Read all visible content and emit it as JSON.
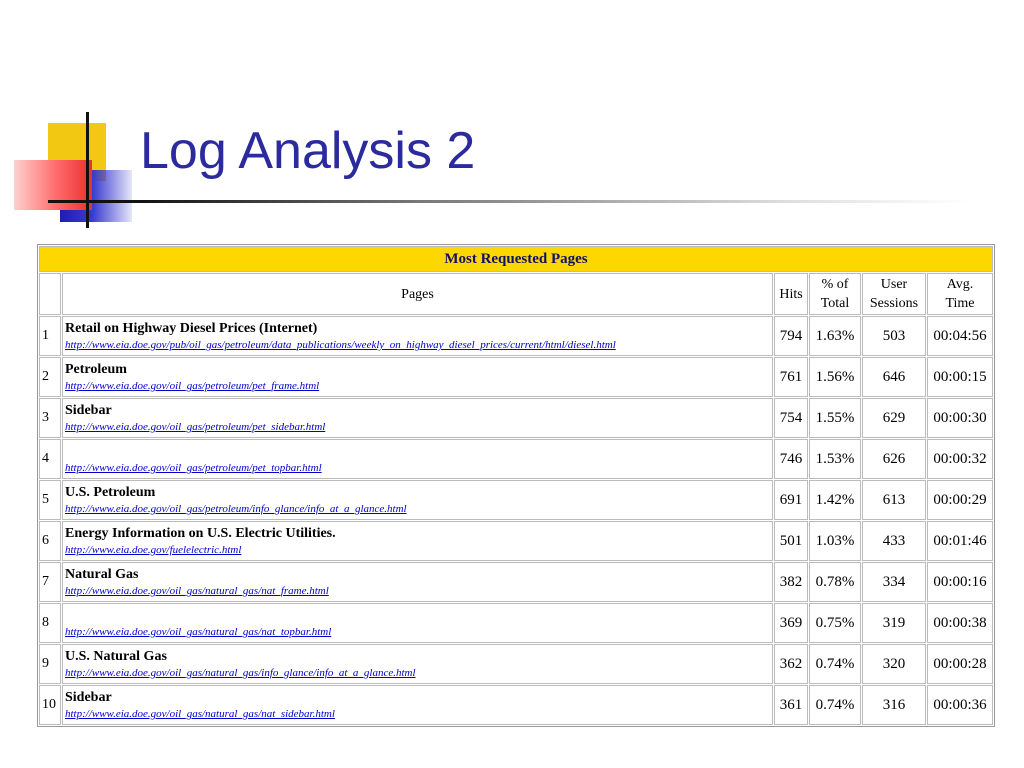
{
  "slide": {
    "title": "Log Analysis 2"
  },
  "table": {
    "caption": "Most Requested Pages",
    "headers": {
      "pages": "Pages",
      "hits": "Hits",
      "pct_line1": "% of",
      "pct_line2": "Total",
      "sessions_line1": "User",
      "sessions_line2": "Sessions",
      "time_line1": "Avg.",
      "time_line2": "Time"
    },
    "rows": [
      {
        "index": "1",
        "title": "Retail on Highway Diesel Prices (Internet)",
        "url": "http://www.eia.doe.gov/pub/oil_gas/petroleum/data_publications/weekly_on_highway_diesel_prices/current/html/diesel.html",
        "hits": "794",
        "pct": "1.63%",
        "sessions": "503",
        "time": "00:04:56"
      },
      {
        "index": "2",
        "title": "Petroleum",
        "url": "http://www.eia.doe.gov/oil_gas/petroleum/pet_frame.html",
        "hits": "761",
        "pct": "1.56%",
        "sessions": "646",
        "time": "00:00:15"
      },
      {
        "index": "3",
        "title": "Sidebar",
        "url": "http://www.eia.doe.gov/oil_gas/petroleum/pet_sidebar.html",
        "hits": "754",
        "pct": "1.55%",
        "sessions": "629",
        "time": "00:00:30"
      },
      {
        "index": "4",
        "title": "",
        "url": "http://www.eia.doe.gov/oil_gas/petroleum/pet_topbar.html",
        "hits": "746",
        "pct": "1.53%",
        "sessions": "626",
        "time": "00:00:32"
      },
      {
        "index": "5",
        "title": "U.S. Petroleum",
        "url": "http://www.eia.doe.gov/oil_gas/petroleum/info_glance/info_at_a_glance.html",
        "hits": "691",
        "pct": "1.42%",
        "sessions": "613",
        "time": "00:00:29"
      },
      {
        "index": "6",
        "title": "Energy Information on U.S. Electric Utilities.",
        "url": "http://www.eia.doe.gov/fuelelectric.html",
        "hits": "501",
        "pct": "1.03%",
        "sessions": "433",
        "time": "00:01:46"
      },
      {
        "index": "7",
        "title": "Natural Gas",
        "url": "http://www.eia.doe.gov/oil_gas/natural_gas/nat_frame.html",
        "hits": "382",
        "pct": "0.78%",
        "sessions": "334",
        "time": "00:00:16"
      },
      {
        "index": "8",
        "title": "",
        "url": "http://www.eia.doe.gov/oil_gas/natural_gas/nat_topbar.html",
        "hits": "369",
        "pct": "0.75%",
        "sessions": "319",
        "time": "00:00:38"
      },
      {
        "index": "9",
        "title": "U.S. Natural Gas",
        "url": "http://www.eia.doe.gov/oil_gas/natural_gas/info_glance/info_at_a_glance.html",
        "hits": "362",
        "pct": "0.74%",
        "sessions": "320",
        "time": "00:00:28"
      },
      {
        "index": "10",
        "title": "Sidebar",
        "url": "http://www.eia.doe.gov/oil_gas/natural_gas/nat_sidebar.html",
        "hits": "361",
        "pct": "0.74%",
        "sessions": "316",
        "time": "00:00:36"
      }
    ]
  }
}
